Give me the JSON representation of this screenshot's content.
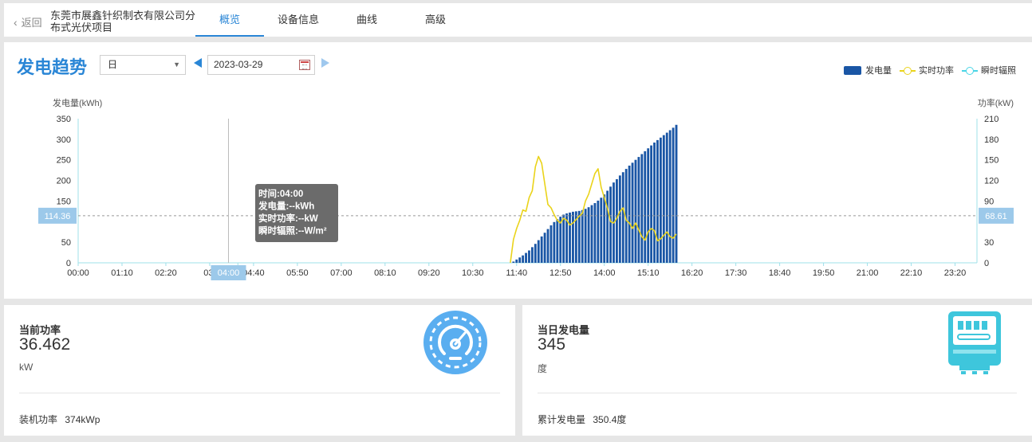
{
  "header": {
    "back_label": "返回",
    "project_title": "东莞市展鑫针织制衣有限公司分布式光伏项目",
    "tabs": [
      {
        "label": "概览",
        "active": true
      },
      {
        "label": "设备信息",
        "active": false
      },
      {
        "label": "曲线",
        "active": false
      },
      {
        "label": "高级",
        "active": false
      }
    ]
  },
  "trend": {
    "title": "发电趋势",
    "period_select": "日",
    "date": "2023-03-29",
    "legend": [
      "发电量",
      "实时功率",
      "瞬时辐照"
    ]
  },
  "chart_data": {
    "type": "bar",
    "ylabel_left": "发电量(kWh)",
    "ylabel_right": "功率(kW)",
    "ylim_left": [
      0,
      350
    ],
    "ylim_right": [
      0,
      210
    ],
    "yticks_left": [
      0,
      50,
      100,
      150,
      200,
      250,
      300,
      350
    ],
    "ytick_labels_left": [
      "0",
      "50",
      "",
      "150",
      "200",
      "250",
      "300",
      "350"
    ],
    "yticks_right": [
      0,
      30,
      60,
      90,
      120,
      150,
      180,
      210
    ],
    "ytick_labels_right": [
      "0",
      "30",
      "",
      "90",
      "120",
      "150",
      "180",
      "210"
    ],
    "x_domain_min": [
      0,
      1435
    ],
    "xtick_labels": [
      "00:00",
      "01:10",
      "02:20",
      "03:",
      "",
      "04:40",
      "05:50",
      "07:00",
      "08:10",
      "09:20",
      "10:30",
      "11:40",
      "12:50",
      "14:00",
      "15:10",
      "16:20",
      "17:30",
      "18:40",
      "19:50",
      "21:00",
      "22:10",
      "23:20"
    ],
    "xtick_minutes": [
      0,
      70,
      140,
      210,
      255,
      280,
      350,
      420,
      490,
      560,
      630,
      700,
      770,
      840,
      910,
      980,
      1050,
      1120,
      1190,
      1260,
      1330,
      1400
    ],
    "series": [
      {
        "name": "发电量",
        "kind": "bar",
        "axis": "left",
        "color": "#1a56a5",
        "x_min": [
          695,
          700,
          705,
          710,
          715,
          720,
          725,
          730,
          735,
          740,
          745,
          750,
          755,
          760,
          765,
          770,
          775,
          780,
          785,
          790,
          795,
          800,
          805,
          810,
          815,
          820,
          825,
          830,
          835,
          840,
          845,
          850,
          855,
          860,
          865,
          870,
          875,
          880,
          885,
          890,
          895,
          900,
          905,
          910,
          915,
          920,
          925,
          930,
          935,
          940,
          945,
          950,
          955
        ],
        "values": [
          3,
          8,
          13,
          18,
          24,
          30,
          38,
          46,
          55,
          64,
          73,
          82,
          91,
          99,
          106,
          112,
          117,
          120,
          122,
          124,
          125,
          126,
          128,
          131,
          135,
          140,
          145,
          151,
          158,
          166,
          175,
          185,
          195,
          203,
          212,
          220,
          228,
          236,
          243,
          250,
          257,
          264,
          271,
          278,
          285,
          292,
          298,
          304,
          310,
          316,
          322,
          328,
          335
        ]
      },
      {
        "name": "实时功率",
        "kind": "line",
        "axis": "right",
        "color": "#ead31a",
        "x_min": [
          690,
          695,
          700,
          705,
          710,
          715,
          720,
          725,
          730,
          735,
          740,
          745,
          750,
          755,
          760,
          765,
          770,
          775,
          780,
          785,
          790,
          795,
          800,
          805,
          810,
          815,
          820,
          825,
          830,
          835,
          840,
          845,
          850,
          855,
          860,
          865,
          870,
          875,
          880,
          885,
          890,
          895,
          900,
          905,
          910,
          915,
          920,
          925,
          930,
          935,
          940,
          945,
          950,
          955
        ],
        "values": [
          0,
          34,
          50,
          62,
          77,
          75,
          95,
          105,
          140,
          155,
          145,
          115,
          85,
          80,
          70,
          62,
          58,
          65,
          62,
          55,
          58,
          63,
          68,
          72,
          90,
          100,
          115,
          130,
          137,
          110,
          95,
          80,
          60,
          58,
          65,
          75,
          80,
          62,
          58,
          50,
          58,
          48,
          38,
          33,
          45,
          50,
          47,
          32,
          35,
          40,
          45,
          38,
          36,
          42
        ]
      },
      {
        "name": "瞬时辐照",
        "kind": "line",
        "axis": "right",
        "color": "#49d5e6",
        "x_min": [],
        "values": []
      }
    ],
    "crosshair": {
      "time_label": "04:00",
      "left_value_label": "114.36",
      "right_value_label": "68.61"
    },
    "tooltip": [
      "时间:04:00",
      "发电量:--kWh",
      "实时功率:--kW",
      "瞬时辐照:--W/m²"
    ]
  },
  "cards": [
    {
      "title": "当前功率",
      "value": "36.462",
      "unit": "kW",
      "foot_label": "装机功率",
      "foot_value": "374kWp",
      "icon": "speedometer-icon",
      "icon_color": "#5aaef0"
    },
    {
      "title": "当日发电量",
      "value": "345",
      "unit": "度",
      "foot_label": "累计发电量",
      "foot_value": "350.4度",
      "icon": "electric-meter-icon",
      "icon_color": "#3ec6dc"
    }
  ]
}
